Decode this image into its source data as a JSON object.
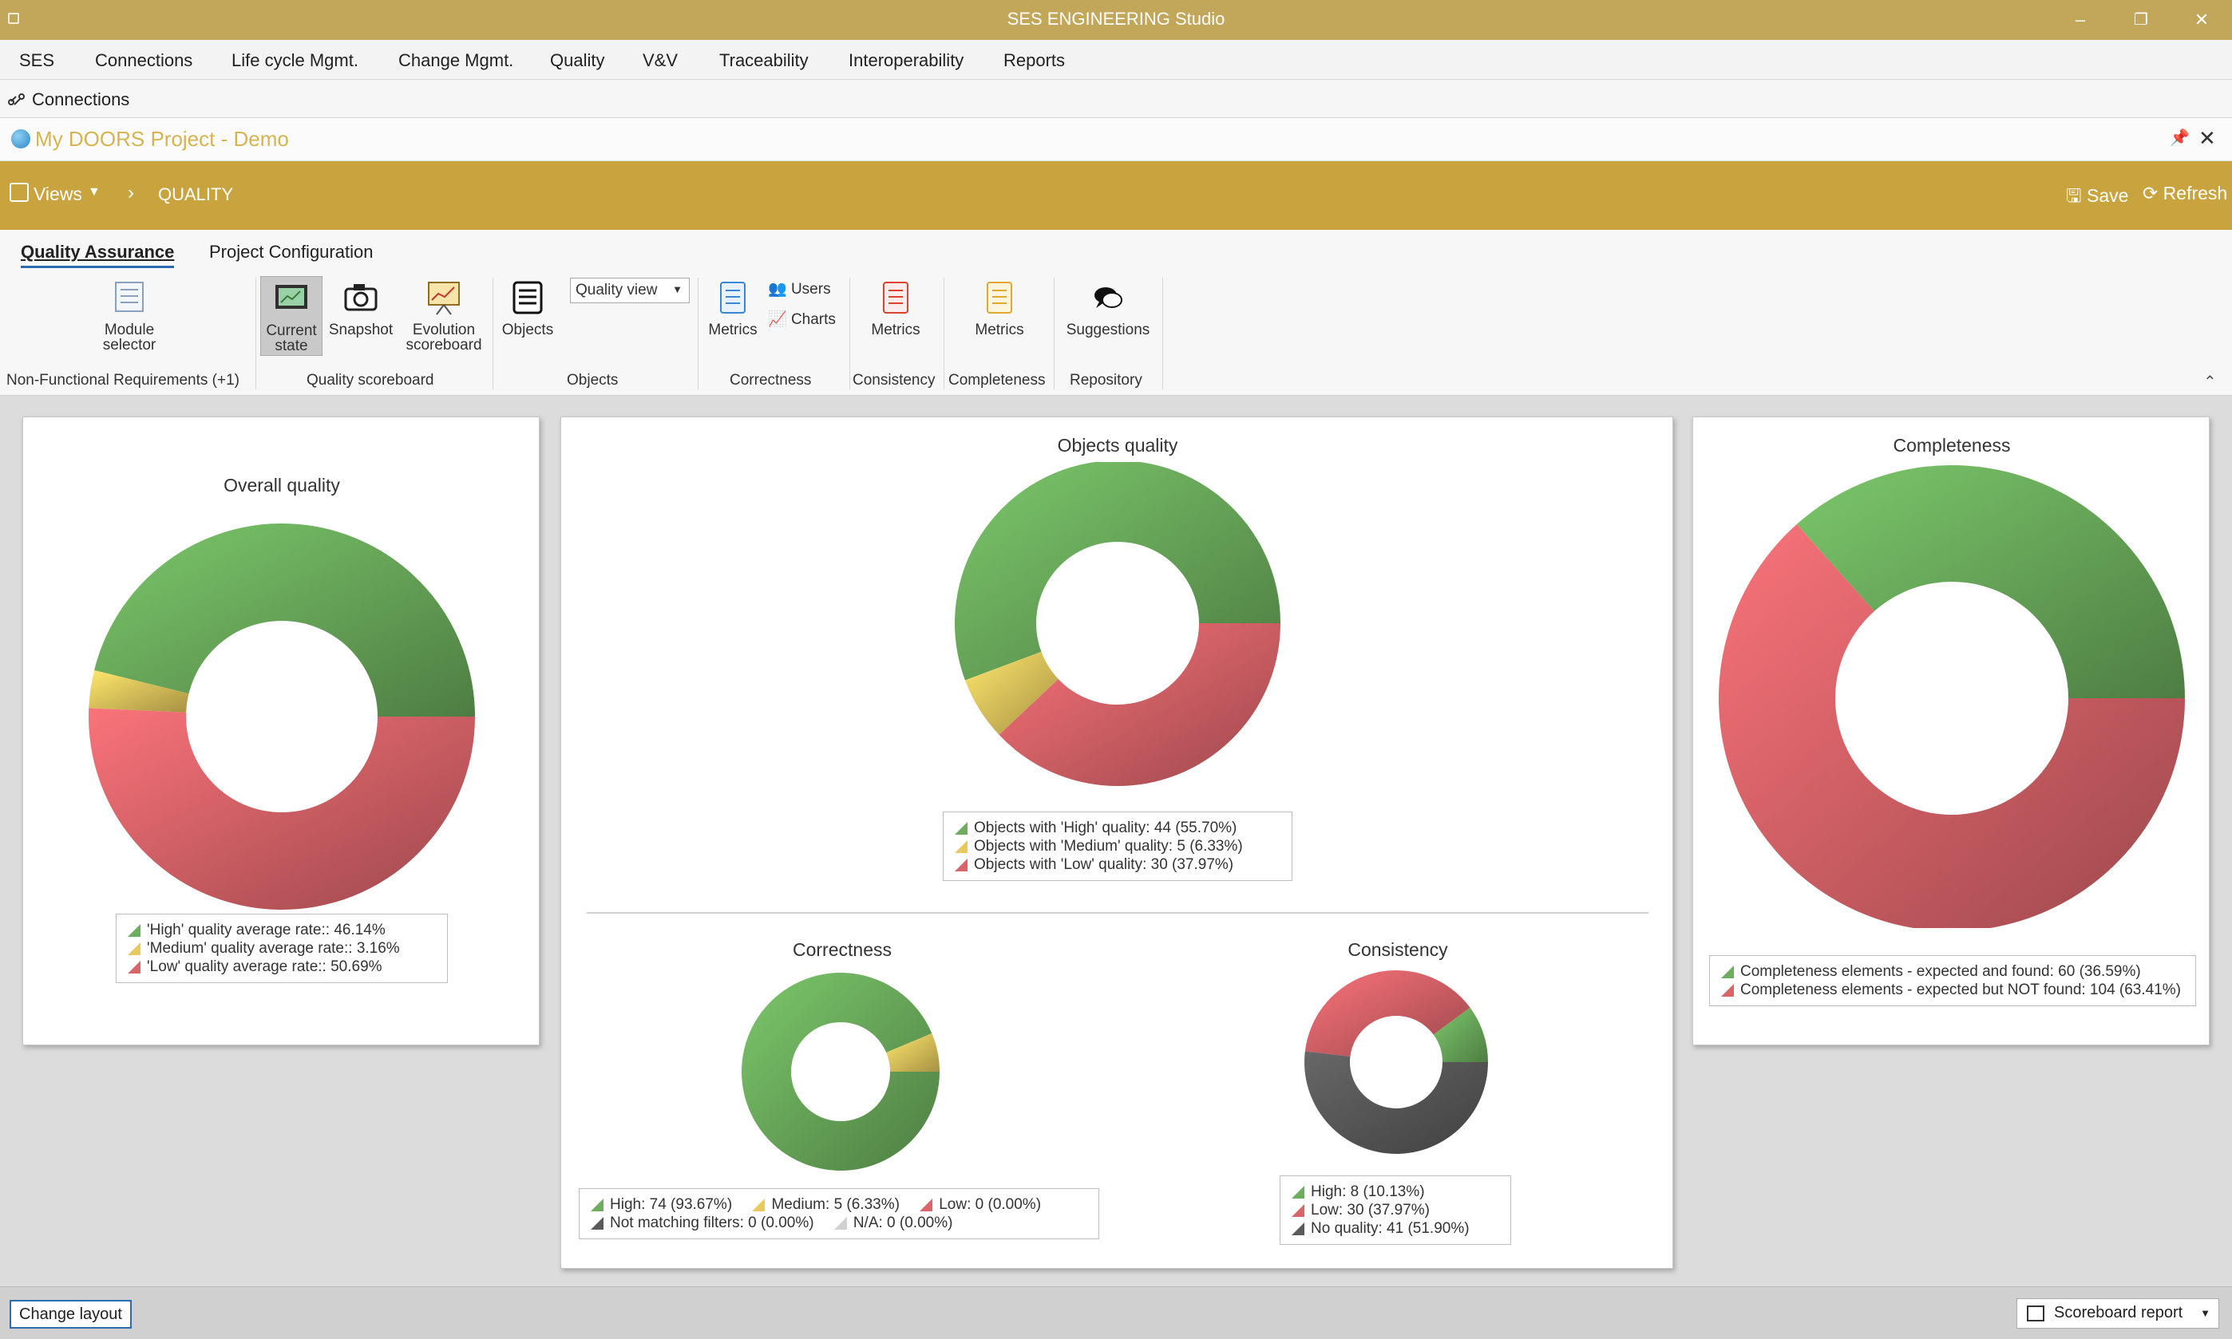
{
  "window": {
    "title": "SES ENGINEERING Studio",
    "minimize": "–",
    "restore": "❐",
    "close": "✕"
  },
  "menu": [
    "SES",
    "Connections",
    "Life cycle Mgmt.",
    "Change Mgmt.",
    "Quality",
    "V&V",
    "Traceability",
    "Interoperability",
    "Reports"
  ],
  "connections_bar": {
    "label": "Connections"
  },
  "project": {
    "title": "My DOORS Project - Demo",
    "pin": "📌",
    "close": "✕"
  },
  "views_bar": {
    "views_label": "Views",
    "breadcrumb_sep": "›",
    "breadcrumb": "QUALITY",
    "save": "Save",
    "refresh": "Refresh"
  },
  "ribbon": {
    "tabs": [
      "Quality Assurance",
      "Project Configuration"
    ],
    "buttons": {
      "module_selector": "Module selector",
      "current_state": "Current state",
      "snapshot": "Snapshot",
      "evolution_scoreboard": "Evolution scoreboard",
      "objects": "Objects",
      "quality_view": "Quality view",
      "correctness_metrics": "Metrics",
      "users": "Users",
      "charts": "Charts",
      "consistency_metrics": "Metrics",
      "completeness_metrics": "Metrics",
      "suggestions": "Suggestions"
    },
    "groups": {
      "nfr": "Non-Functional Requirements (+1)",
      "quality_scoreboard": "Quality scoreboard",
      "objects": "Objects",
      "correctness": "Correctness",
      "consistency": "Consistency",
      "completeness": "Completeness",
      "repository": "Repository"
    }
  },
  "colors": {
    "high": "#6cae5d",
    "medium": "#e7c95e",
    "low": "#d9646a",
    "none": "#5a5a5a",
    "na": "#d0d0d0",
    "accent": "#c9a43e"
  },
  "chart_data": [
    {
      "id": "overall",
      "type": "pie",
      "title": "Overall quality",
      "categories": [
        "'High' quality average rate:",
        "'Medium' quality average rate:",
        "'Low' quality average rate:"
      ],
      "values": [
        46.14,
        3.16,
        50.69
      ],
      "legend": [
        "'High' quality average rate:: 46.14%",
        "'Medium' quality average rate:: 3.16%",
        "'Low' quality average rate:: 50.69%"
      ]
    },
    {
      "id": "objects",
      "type": "pie",
      "title": "Objects quality",
      "categories": [
        "High",
        "Medium",
        "Low"
      ],
      "values": [
        44,
        5,
        30
      ],
      "legend": [
        "Objects with 'High' quality: 44 (55.70%)",
        "Objects with 'Medium' quality: 5 (6.33%)",
        "Objects with 'Low' quality: 30 (37.97%)"
      ]
    },
    {
      "id": "correctness",
      "type": "pie",
      "title": "Correctness",
      "categories": [
        "High",
        "Medium",
        "Low",
        "Not matching filters",
        "N/A"
      ],
      "values": [
        74,
        5,
        0,
        0,
        0
      ],
      "legend": [
        "High: 74 (93.67%)",
        "Medium: 5 (6.33%)",
        "Low: 0 (0.00%)",
        "Not matching filters: 0 (0.00%)",
        "N/A: 0 (0.00%)"
      ]
    },
    {
      "id": "consistency",
      "type": "pie",
      "title": "Consistency",
      "categories": [
        "High",
        "Low",
        "No quality"
      ],
      "values": [
        8,
        30,
        41
      ],
      "legend": [
        "High: 8 (10.13%)",
        "Low: 30 (37.97%)",
        "No quality: 41 (51.90%)"
      ]
    },
    {
      "id": "completeness",
      "type": "pie",
      "title": "Completeness",
      "categories": [
        "expected and found",
        "expected but NOT found"
      ],
      "values": [
        60,
        104
      ],
      "legend": [
        "Completeness elements - expected and found: 60 (36.59%)",
        "Completeness elements - expected but NOT found: 104 (63.41%)"
      ]
    }
  ],
  "status": {
    "change_layout": "Change layout",
    "scoreboard_report": "Scoreboard report"
  }
}
